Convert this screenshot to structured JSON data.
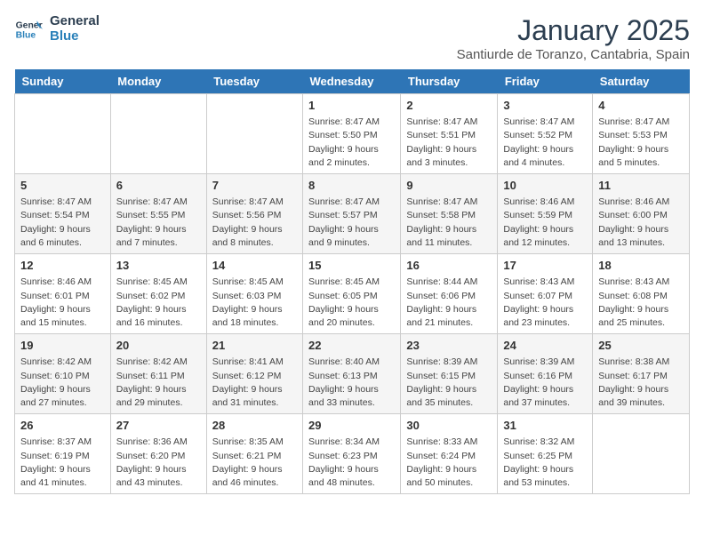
{
  "header": {
    "logo_line1": "General",
    "logo_line2": "Blue",
    "month": "January 2025",
    "location": "Santiurde de Toranzo, Cantabria, Spain"
  },
  "days_of_week": [
    "Sunday",
    "Monday",
    "Tuesday",
    "Wednesday",
    "Thursday",
    "Friday",
    "Saturday"
  ],
  "weeks": [
    [
      {
        "day": "",
        "content": ""
      },
      {
        "day": "",
        "content": ""
      },
      {
        "day": "",
        "content": ""
      },
      {
        "day": "1",
        "content": "Sunrise: 8:47 AM\nSunset: 5:50 PM\nDaylight: 9 hours and 2 minutes."
      },
      {
        "day": "2",
        "content": "Sunrise: 8:47 AM\nSunset: 5:51 PM\nDaylight: 9 hours and 3 minutes."
      },
      {
        "day": "3",
        "content": "Sunrise: 8:47 AM\nSunset: 5:52 PM\nDaylight: 9 hours and 4 minutes."
      },
      {
        "day": "4",
        "content": "Sunrise: 8:47 AM\nSunset: 5:53 PM\nDaylight: 9 hours and 5 minutes."
      }
    ],
    [
      {
        "day": "5",
        "content": "Sunrise: 8:47 AM\nSunset: 5:54 PM\nDaylight: 9 hours and 6 minutes."
      },
      {
        "day": "6",
        "content": "Sunrise: 8:47 AM\nSunset: 5:55 PM\nDaylight: 9 hours and 7 minutes."
      },
      {
        "day": "7",
        "content": "Sunrise: 8:47 AM\nSunset: 5:56 PM\nDaylight: 9 hours and 8 minutes."
      },
      {
        "day": "8",
        "content": "Sunrise: 8:47 AM\nSunset: 5:57 PM\nDaylight: 9 hours and 9 minutes."
      },
      {
        "day": "9",
        "content": "Sunrise: 8:47 AM\nSunset: 5:58 PM\nDaylight: 9 hours and 11 minutes."
      },
      {
        "day": "10",
        "content": "Sunrise: 8:46 AM\nSunset: 5:59 PM\nDaylight: 9 hours and 12 minutes."
      },
      {
        "day": "11",
        "content": "Sunrise: 8:46 AM\nSunset: 6:00 PM\nDaylight: 9 hours and 13 minutes."
      }
    ],
    [
      {
        "day": "12",
        "content": "Sunrise: 8:46 AM\nSunset: 6:01 PM\nDaylight: 9 hours and 15 minutes."
      },
      {
        "day": "13",
        "content": "Sunrise: 8:45 AM\nSunset: 6:02 PM\nDaylight: 9 hours and 16 minutes."
      },
      {
        "day": "14",
        "content": "Sunrise: 8:45 AM\nSunset: 6:03 PM\nDaylight: 9 hours and 18 minutes."
      },
      {
        "day": "15",
        "content": "Sunrise: 8:45 AM\nSunset: 6:05 PM\nDaylight: 9 hours and 20 minutes."
      },
      {
        "day": "16",
        "content": "Sunrise: 8:44 AM\nSunset: 6:06 PM\nDaylight: 9 hours and 21 minutes."
      },
      {
        "day": "17",
        "content": "Sunrise: 8:43 AM\nSunset: 6:07 PM\nDaylight: 9 hours and 23 minutes."
      },
      {
        "day": "18",
        "content": "Sunrise: 8:43 AM\nSunset: 6:08 PM\nDaylight: 9 hours and 25 minutes."
      }
    ],
    [
      {
        "day": "19",
        "content": "Sunrise: 8:42 AM\nSunset: 6:10 PM\nDaylight: 9 hours and 27 minutes."
      },
      {
        "day": "20",
        "content": "Sunrise: 8:42 AM\nSunset: 6:11 PM\nDaylight: 9 hours and 29 minutes."
      },
      {
        "day": "21",
        "content": "Sunrise: 8:41 AM\nSunset: 6:12 PM\nDaylight: 9 hours and 31 minutes."
      },
      {
        "day": "22",
        "content": "Sunrise: 8:40 AM\nSunset: 6:13 PM\nDaylight: 9 hours and 33 minutes."
      },
      {
        "day": "23",
        "content": "Sunrise: 8:39 AM\nSunset: 6:15 PM\nDaylight: 9 hours and 35 minutes."
      },
      {
        "day": "24",
        "content": "Sunrise: 8:39 AM\nSunset: 6:16 PM\nDaylight: 9 hours and 37 minutes."
      },
      {
        "day": "25",
        "content": "Sunrise: 8:38 AM\nSunset: 6:17 PM\nDaylight: 9 hours and 39 minutes."
      }
    ],
    [
      {
        "day": "26",
        "content": "Sunrise: 8:37 AM\nSunset: 6:19 PM\nDaylight: 9 hours and 41 minutes."
      },
      {
        "day": "27",
        "content": "Sunrise: 8:36 AM\nSunset: 6:20 PM\nDaylight: 9 hours and 43 minutes."
      },
      {
        "day": "28",
        "content": "Sunrise: 8:35 AM\nSunset: 6:21 PM\nDaylight: 9 hours and 46 minutes."
      },
      {
        "day": "29",
        "content": "Sunrise: 8:34 AM\nSunset: 6:23 PM\nDaylight: 9 hours and 48 minutes."
      },
      {
        "day": "30",
        "content": "Sunrise: 8:33 AM\nSunset: 6:24 PM\nDaylight: 9 hours and 50 minutes."
      },
      {
        "day": "31",
        "content": "Sunrise: 8:32 AM\nSunset: 6:25 PM\nDaylight: 9 hours and 53 minutes."
      },
      {
        "day": "",
        "content": ""
      }
    ]
  ]
}
